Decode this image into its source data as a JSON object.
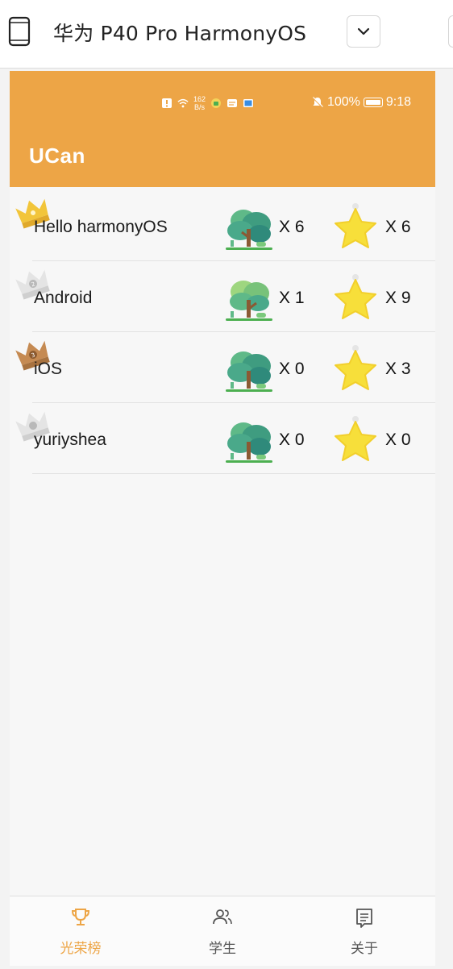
{
  "device_bar": {
    "device_name": "华为 P40 Pro HarmonyOS",
    "icons": [
      "phone-icon",
      "chevron-down-icon"
    ]
  },
  "status_bar": {
    "net_speed_value": "162",
    "net_speed_unit": "B/s",
    "battery": "100%",
    "time": "9:18"
  },
  "app": {
    "title": "UCan",
    "accent_color": "#eda546"
  },
  "leaderboard": [
    {
      "rank": 1,
      "name": "Hello harmonyOS",
      "trees": "X 6",
      "stars": "X 6",
      "crown": "gold-crown-icon"
    },
    {
      "rank": 2,
      "name": "Android",
      "trees": "X 1",
      "stars": "X 9",
      "crown": "silver-crown-icon"
    },
    {
      "rank": 3,
      "name": "iOS",
      "trees": "X 0",
      "stars": "X 3",
      "crown": "bronze-crown-icon"
    },
    {
      "rank": 4,
      "name": "yuriyshea",
      "trees": "X 0",
      "stars": "X 0",
      "crown": "silver-crown-icon"
    }
  ],
  "tabs": [
    {
      "label": "光荣榜",
      "icon": "trophy-icon",
      "active": true
    },
    {
      "label": "学生",
      "icon": "people-icon",
      "active": false
    },
    {
      "label": "关于",
      "icon": "notes-icon",
      "active": false
    }
  ]
}
